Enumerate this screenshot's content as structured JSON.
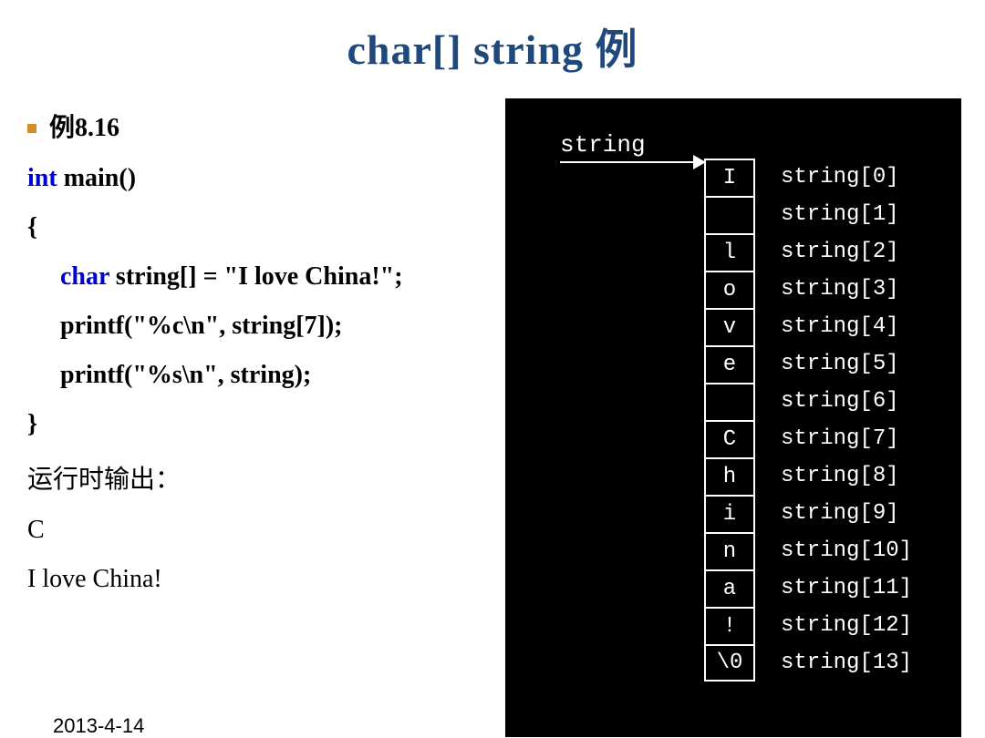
{
  "title": "char[] string 例",
  "lines": {
    "example_label": "例8.16",
    "int": "int",
    "main_rest": " main()",
    "brace_open": "{",
    "char": "char",
    "decl_rest": " string[] = \"I love China!\";",
    "printf1": "printf(\"%c\\n\", string[7]);",
    "printf2": "printf(\"%s\\n\", string);",
    "brace_close": "}",
    "runlabel": "运行时输出：",
    "out1": "C",
    "out2": "I love China!"
  },
  "footer_date": "2013-4-14",
  "diagram": {
    "pointer_label": "string",
    "cells": [
      "I",
      "",
      "l",
      "o",
      "v",
      "e",
      "",
      "C",
      "h",
      "i",
      "n",
      "a",
      "!",
      "\\0"
    ],
    "labels": [
      "string[0]",
      "string[1]",
      "string[2]",
      "string[3]",
      "string[4]",
      "string[5]",
      "string[6]",
      "string[7]",
      "string[8]",
      "string[9]",
      "string[10]",
      "string[11]",
      "string[12]",
      "string[13]"
    ]
  }
}
